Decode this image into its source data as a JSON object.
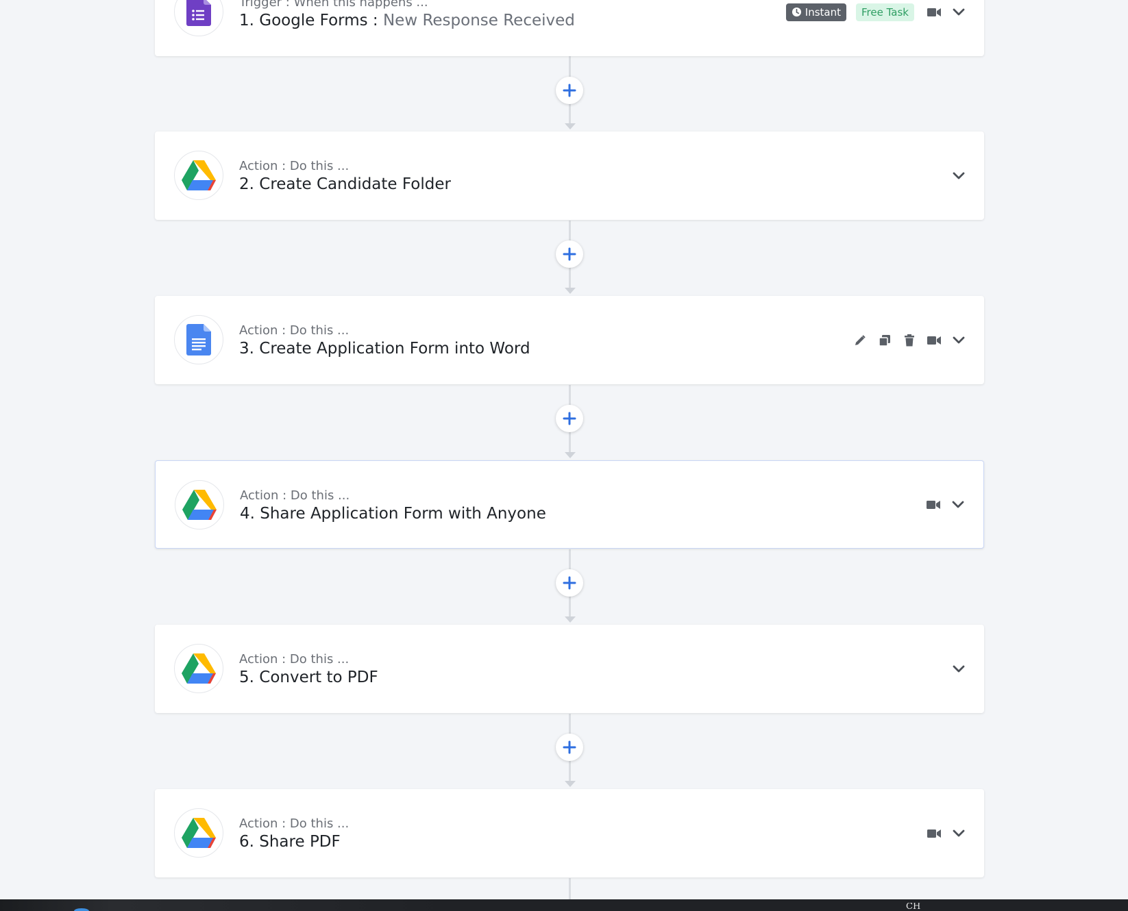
{
  "steps": [
    {
      "subtitle": "Trigger : When this happens ...",
      "title": "1. Google Forms :",
      "event": "New Response Received",
      "app_icon": "google-forms-icon",
      "badges": {
        "instant": "Instant",
        "free_task": "Free Task"
      }
    },
    {
      "subtitle": "Action : Do this ...",
      "title": "2. Create Candidate Folder",
      "app_icon": "google-drive-icon"
    },
    {
      "subtitle": "Action : Do this ...",
      "title": "3. Create Application Form into Word",
      "app_icon": "google-docs-icon"
    },
    {
      "subtitle": "Action : Do this ...",
      "title": "4. Share Application Form with Anyone",
      "app_icon": "google-drive-icon"
    },
    {
      "subtitle": "Action : Do this ...",
      "title": "5. Convert to PDF",
      "app_icon": "google-drive-icon"
    },
    {
      "subtitle": "Action : Do this ...",
      "title": "6. Share PDF",
      "app_icon": "google-drive-icon"
    }
  ],
  "taskbar": {
    "lang": "CH"
  },
  "colors": {
    "background": "#f3f5f8",
    "plus": "#2f6fe0",
    "forms_purple": "#6f3fc4",
    "docs_blue": "#4a86f0",
    "drive_green": "#1ea362",
    "drive_yellow": "#ffba00",
    "drive_blue": "#4285f4",
    "drive_red": "#ea4335",
    "free_task_bg": "#d9f5e6",
    "instant_bg": "#5c6169"
  }
}
